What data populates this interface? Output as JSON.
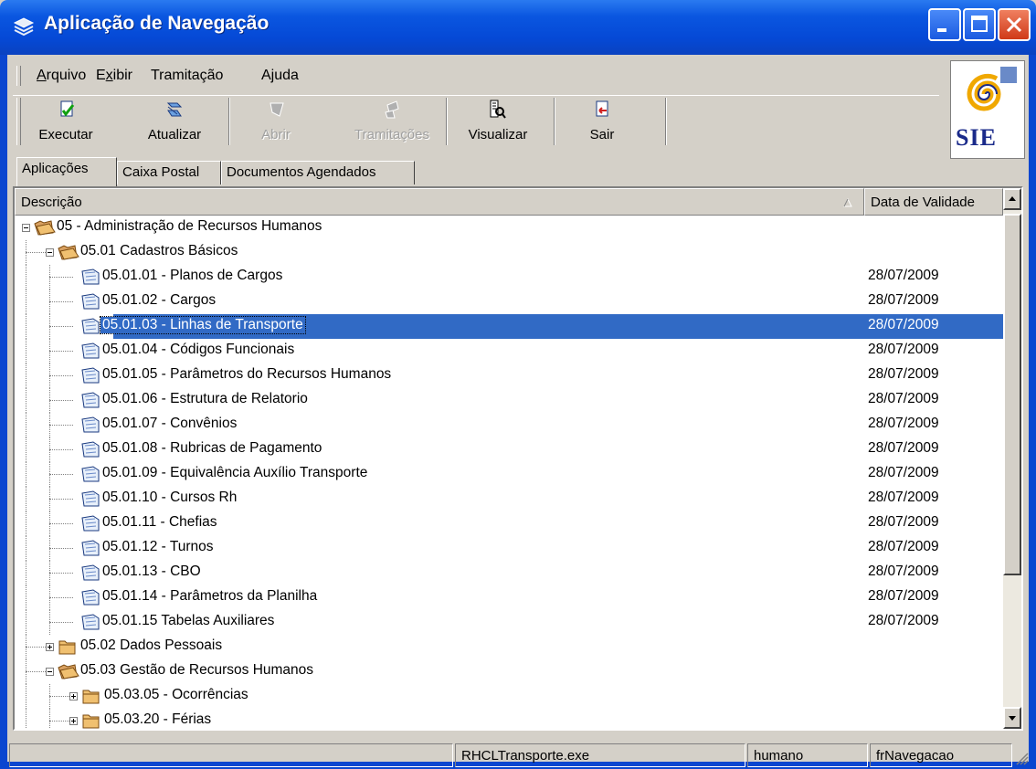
{
  "window": {
    "title": "Aplicação de Navegação",
    "icon": "stack-icon"
  },
  "menu": {
    "items": [
      "Arquivo",
      "Exibir",
      "Tramitação",
      "Ajuda"
    ],
    "mnemonics": [
      "A",
      "x",
      "",
      "j"
    ]
  },
  "toolbar": {
    "buttons": [
      {
        "label": "Executar",
        "icon": "execute-icon",
        "enabled": true
      },
      {
        "label": "Atualizar",
        "icon": "refresh-icon",
        "enabled": true
      },
      {
        "label": "Abrir",
        "icon": "open-icon",
        "enabled": false
      },
      {
        "label": "Tramitações",
        "icon": "routing-icon",
        "enabled": false
      },
      {
        "label": "Visualizar",
        "icon": "view-icon",
        "enabled": true
      },
      {
        "label": "Sair",
        "icon": "exit-icon",
        "enabled": true
      }
    ]
  },
  "logo": {
    "text": "SIE"
  },
  "tabs": [
    {
      "label": "Aplicações",
      "active": true
    },
    {
      "label": "Caixa Postal",
      "active": false
    },
    {
      "label": "Documentos Agendados",
      "active": false
    }
  ],
  "list": {
    "columns": [
      "Descrição",
      "Data de Validade"
    ],
    "rows": [
      {
        "level": 0,
        "label": "05 - Administração de Recursos Humanos",
        "kind": "folder-open",
        "expander": "minus",
        "date": ""
      },
      {
        "level": 1,
        "label": "05.01 Cadastros Básicos",
        "kind": "folder-open",
        "expander": "minus",
        "date": ""
      },
      {
        "level": 2,
        "label": "05.01.01 - Planos de Cargos",
        "kind": "form",
        "date": "28/07/2009"
      },
      {
        "level": 2,
        "label": "05.01.02 - Cargos",
        "kind": "form",
        "date": "28/07/2009"
      },
      {
        "level": 2,
        "label": "05.01.03 - Linhas de Transporte",
        "kind": "form",
        "date": "28/07/2009",
        "selected": true
      },
      {
        "level": 2,
        "label": "05.01.04 - Códigos Funcionais",
        "kind": "form",
        "date": "28/07/2009"
      },
      {
        "level": 2,
        "label": "05.01.05 - Parâmetros do Recursos Humanos",
        "kind": "form",
        "date": "28/07/2009"
      },
      {
        "level": 2,
        "label": "05.01.06 - Estrutura de Relatorio",
        "kind": "form",
        "date": "28/07/2009"
      },
      {
        "level": 2,
        "label": "05.01.07 - Convênios",
        "kind": "form",
        "date": "28/07/2009"
      },
      {
        "level": 2,
        "label": "05.01.08 - Rubricas de Pagamento",
        "kind": "form",
        "date": "28/07/2009"
      },
      {
        "level": 2,
        "label": "05.01.09 - Equivalência Auxílio Transporte",
        "kind": "form",
        "date": "28/07/2009"
      },
      {
        "level": 2,
        "label": "05.01.10 - Cursos Rh",
        "kind": "form",
        "date": "28/07/2009"
      },
      {
        "level": 2,
        "label": "05.01.11 - Chefias",
        "kind": "form",
        "date": "28/07/2009"
      },
      {
        "level": 2,
        "label": "05.01.12 - Turnos",
        "kind": "form",
        "date": "28/07/2009"
      },
      {
        "level": 2,
        "label": "05.01.13 - CBO",
        "kind": "form",
        "date": "28/07/2009"
      },
      {
        "level": 2,
        "label": "05.01.14 - Parâmetros da Planilha",
        "kind": "form",
        "date": "28/07/2009"
      },
      {
        "level": 2,
        "label": "05.01.15  Tabelas Auxiliares",
        "kind": "form",
        "date": "28/07/2009"
      },
      {
        "level": 1,
        "label": "05.02 Dados Pessoais",
        "kind": "folder",
        "expander": "plus",
        "date": ""
      },
      {
        "level": 1,
        "label": "05.03 Gestão de Recursos Humanos",
        "kind": "folder-open",
        "expander": "minus",
        "date": ""
      },
      {
        "level": 2,
        "label": "05.03.05 - Ocorrências",
        "kind": "folder",
        "expander": "plus",
        "date": ""
      },
      {
        "level": 2,
        "label": "05.03.20 - Férias",
        "kind": "folder",
        "expander": "plus",
        "date": ""
      }
    ]
  },
  "status": {
    "cells": [
      "",
      "RHCLTransporte.exe",
      "humano",
      "frNavegacao"
    ]
  },
  "colors": {
    "titlebar": "#0549d6",
    "selection": "#316ac5",
    "chrome": "#d4d0c8"
  }
}
